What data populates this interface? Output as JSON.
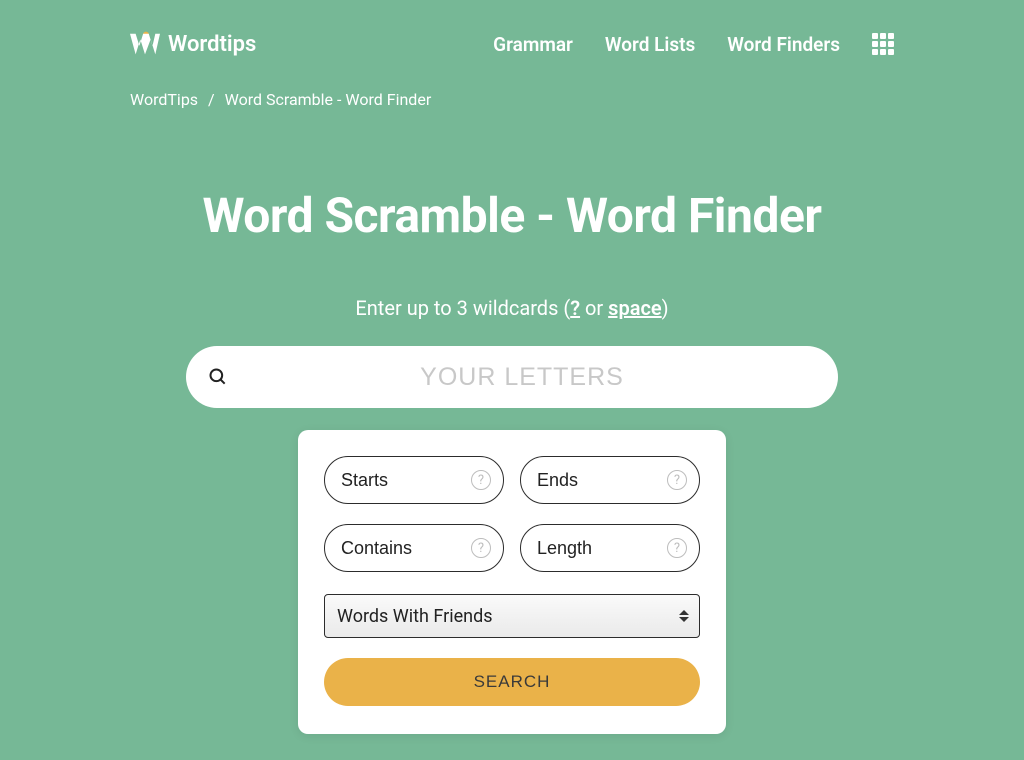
{
  "brand": {
    "name": "Wordtips"
  },
  "nav": {
    "items": [
      {
        "label": "Grammar"
      },
      {
        "label": "Word Lists"
      },
      {
        "label": "Word Finders"
      }
    ]
  },
  "breadcrumb": {
    "root": "WordTips",
    "current": "Word Scramble - Word Finder"
  },
  "hero": {
    "title": "Word Scramble - Word Finder",
    "subtitle_pre": "Enter up to 3 wildcards (",
    "wildcard1": "?",
    "subtitle_mid": " or ",
    "wildcard2": "space",
    "subtitle_post": ")"
  },
  "search": {
    "placeholder": "YOUR LETTERS",
    "value": ""
  },
  "filters": {
    "starts": {
      "placeholder": "Starts",
      "value": ""
    },
    "ends": {
      "placeholder": "Ends",
      "value": ""
    },
    "contains": {
      "placeholder": "Contains",
      "value": ""
    },
    "length": {
      "placeholder": "Length",
      "value": ""
    }
  },
  "dictionary": {
    "selected": "Words With Friends"
  },
  "actions": {
    "search": "SEARCH"
  },
  "colors": {
    "bg": "#76b896",
    "accent": "#eab249"
  }
}
